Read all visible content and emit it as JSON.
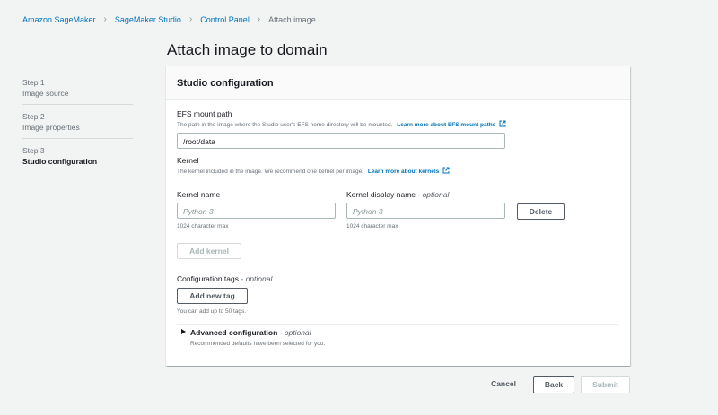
{
  "breadcrumb": {
    "items": [
      "Amazon SageMaker",
      "SageMaker Studio",
      "Control Panel"
    ],
    "current": "Attach image"
  },
  "page": {
    "title": "Attach image to domain"
  },
  "steps": [
    {
      "num": "Step 1",
      "label": "Image source"
    },
    {
      "num": "Step 2",
      "label": "Image properties"
    },
    {
      "num": "Step 3",
      "label": "Studio configuration"
    }
  ],
  "panel": {
    "title": "Studio configuration",
    "efs": {
      "label": "EFS mount path",
      "description": "The path in the image where the Studio user's EFS home directory will be mounted.",
      "link": "Learn more about EFS mount paths",
      "value": "/root/data"
    },
    "kernel": {
      "label": "Kernel",
      "description": "The kernel included in the image. We recommend one kernel per image.",
      "link": "Learn more about kernels",
      "name_label": "Kernel name",
      "name_placeholder": "Python 3",
      "name_hint": "1024 character max",
      "display_label": "Kernel display name",
      "display_optional": "- optional",
      "display_placeholder": "Python 3",
      "display_hint": "1024 character max",
      "delete": "Delete",
      "add": "Add kernel"
    },
    "tags": {
      "label": "Configuration tags",
      "optional": "- optional",
      "add": "Add new tag",
      "hint": "You can add up to 50 tags."
    },
    "advanced": {
      "label": "Advanced configuration",
      "optional": "- optional",
      "description": "Recommended defaults have been selected for you."
    }
  },
  "footer": {
    "cancel": "Cancel",
    "back": "Back",
    "submit": "Submit"
  },
  "colors": {
    "link": "#0073bb",
    "text": "#16191f",
    "muted": "#687078",
    "background": "#f2f3f3"
  }
}
